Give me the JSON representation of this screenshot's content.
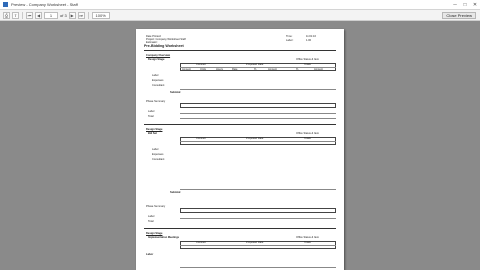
{
  "window": {
    "title": "Preview - Company Worksheet - Staff",
    "minimize_glyph": "─",
    "maximize_glyph": "□",
    "close_glyph": "✕"
  },
  "toolbar": {
    "icons": [
      "print-icon",
      "export-icon",
      "first-page-icon",
      "prev-page-icon",
      "next-page-icon",
      "last-page-icon"
    ],
    "page_value": "1",
    "page_of": "of 3",
    "zoom_value": "100%",
    "close_label": "Close Preview"
  },
  "report": {
    "header_left": [
      "Date Printed:",
      "Project: Company Worksheet Staff",
      "Estimator:"
    ],
    "header_right": [
      "Time:",
      "Labor:"
    ],
    "header_right_values": [
      "11:01:16",
      "1.00"
    ],
    "title": "Pre-Bidding Worksheet",
    "sections": [
      {
        "heading": "Company Overview",
        "sub": "Design Stage",
        "note": "Office Status & Item"
      },
      {
        "heading": "Design Stage",
        "sub": "Bid Set",
        "note": "Office Status & Item"
      },
      {
        "heading": "Design Stage",
        "sub": "Implementation Meetings",
        "note": "Office Status & Item"
      }
    ],
    "col_headers": [
      "Item",
      "Amount",
      "Units",
      "Hours",
      "Rate",
      "%",
      "Amount",
      "%",
      "Amount"
    ],
    "group_headers": [
      "Contract",
      "Proposed Rate",
      "Totals"
    ],
    "row_labels": [
      "Labor",
      "Expenses",
      "Consultant"
    ],
    "subtotal_label": "Subtotal",
    "phase_label": "Phase Summary",
    "phase_rows": [
      "Labor",
      "Total"
    ],
    "footer_label": "Labor"
  }
}
